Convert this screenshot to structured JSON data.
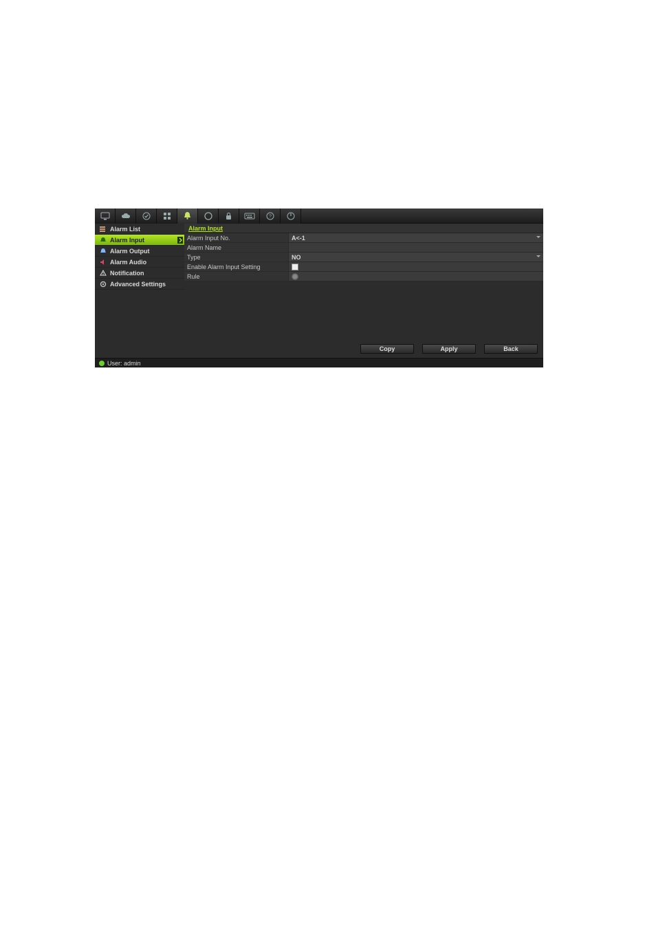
{
  "toolbar": {
    "icons": [
      "monitor-icon",
      "cloud-icon",
      "check-icon",
      "grid-icon",
      "bell-icon",
      "circle-icon",
      "lock-icon",
      "keyboard-icon",
      "help-icon",
      "power-icon"
    ],
    "active_index": 4
  },
  "sidebar": {
    "items": [
      {
        "icon": "list-icon",
        "label": "Alarm List"
      },
      {
        "icon": "input-icon",
        "label": "Alarm Input"
      },
      {
        "icon": "output-icon",
        "label": "Alarm Output"
      },
      {
        "icon": "audio-icon",
        "label": "Alarm Audio"
      },
      {
        "icon": "notify-icon",
        "label": "Notification"
      },
      {
        "icon": "gear-icon",
        "label": "Advanced Settings"
      }
    ],
    "active_index": 1
  },
  "main": {
    "section_title": "Alarm Input",
    "fields": {
      "alarm_input_no": {
        "label": "Alarm Input No.",
        "value": "A<-1"
      },
      "alarm_name": {
        "label": "Alarm Name",
        "value": ""
      },
      "type": {
        "label": "Type",
        "value": "NO"
      },
      "enable_setting": {
        "label": "Enable Alarm Input Setting",
        "checked": false
      },
      "rule": {
        "label": "Rule"
      }
    }
  },
  "buttons": {
    "copy": "Copy",
    "apply": "Apply",
    "back": "Back"
  },
  "status": {
    "user_label": "User: admin"
  },
  "colors": {
    "accent": "#a2d61a"
  }
}
